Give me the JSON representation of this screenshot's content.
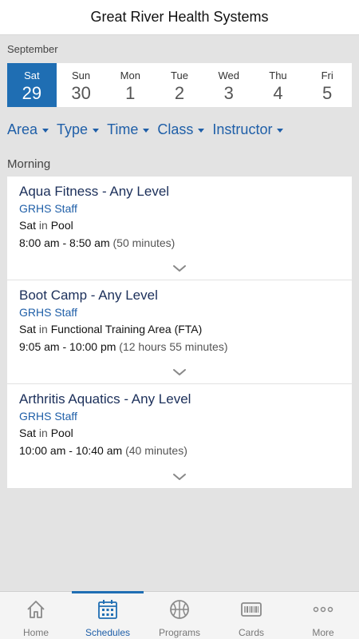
{
  "header": {
    "title": "Great River Health Systems"
  },
  "calendar": {
    "month": "September",
    "days": [
      {
        "name": "Sat",
        "num": "29",
        "selected": true
      },
      {
        "name": "Sun",
        "num": "30"
      },
      {
        "name": "Mon",
        "num": "1"
      },
      {
        "name": "Tue",
        "num": "2"
      },
      {
        "name": "Wed",
        "num": "3"
      },
      {
        "name": "Thu",
        "num": "4"
      },
      {
        "name": "Fri",
        "num": "5"
      }
    ]
  },
  "filters": [
    "Area",
    "Type",
    "Time",
    "Class",
    "Instructor"
  ],
  "section": "Morning",
  "classes": [
    {
      "name": "Aqua Fitness - Any Level",
      "staff": "GRHS Staff",
      "day": "Sat",
      "in": "in",
      "location": "Pool",
      "time": "8:00 am - 8:50 am",
      "duration": "(50 minutes)"
    },
    {
      "name": "Boot Camp - Any Level",
      "staff": "GRHS Staff",
      "day": "Sat",
      "in": "in",
      "location": "Functional Training Area (FTA)",
      "time": "9:05 am - 10:00 pm",
      "duration": "(12 hours 55 minutes)"
    },
    {
      "name": "Arthritis Aquatics - Any Level",
      "staff": "GRHS Staff",
      "day": "Sat",
      "in": "in",
      "location": "Pool",
      "time": "10:00 am - 10:40 am",
      "duration": "(40 minutes)"
    }
  ],
  "tabs": [
    {
      "label": "Home",
      "icon": "home-icon"
    },
    {
      "label": "Schedules",
      "icon": "calendar-icon",
      "active": true
    },
    {
      "label": "Programs",
      "icon": "basketball-icon"
    },
    {
      "label": "Cards",
      "icon": "barcode-card-icon"
    },
    {
      "label": "More",
      "icon": "more-dots-icon"
    }
  ],
  "colors": {
    "accent": "#1f6eb3",
    "link": "#1f5fa8",
    "title": "#1b2f5a"
  }
}
